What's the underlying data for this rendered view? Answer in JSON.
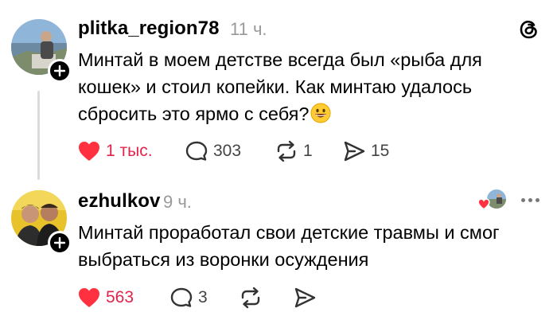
{
  "app": {
    "logo_icon": "threads-logo-icon"
  },
  "colors": {
    "like": "#ff3040",
    "like_text": "#e0244c",
    "muted": "#999999",
    "icon": "#444444"
  },
  "posts": [
    {
      "username": "plitka_region78",
      "time": "11 ч.",
      "text_lines": [
        "Минтай в моем детстве всегда был «рыба для",
        "кошек» и стоил копейки. Как минтаю удалось",
        "сбросить это ярмо с себя?"
      ],
      "emoji": "grinning-face-icon",
      "liked": true,
      "likes": "1 тыс.",
      "comments": "303",
      "reposts": "1",
      "shares": "15"
    },
    {
      "username": "ezhulkov",
      "time": "9 ч.",
      "text_lines": [
        "Минтай проработал свои детские травмы и смог",
        "выбраться из воронки осуждения"
      ],
      "liked": true,
      "likes": "563",
      "comments": "3",
      "reposts": "",
      "shares": ""
    }
  ]
}
